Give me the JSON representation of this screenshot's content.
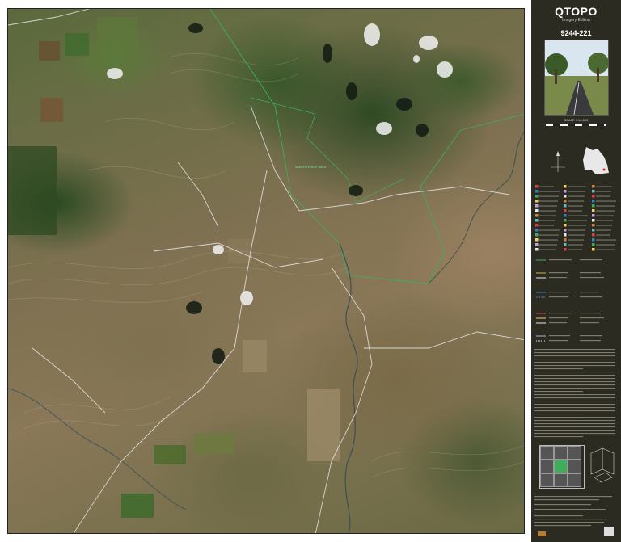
{
  "legend": {
    "title": "QTOPO",
    "subtitle": "Imagery Edition",
    "sheet_number": "9244-221",
    "scale": "SCALE 1:10,000"
  },
  "map": {
    "feature_label": "NAMED FOREST AREA"
  },
  "colors": {
    "legend_bg": "#2c2b22",
    "boundary_green": "#3fae5a",
    "road_white": "#e8e8e8",
    "contour": "#c9c39a"
  }
}
